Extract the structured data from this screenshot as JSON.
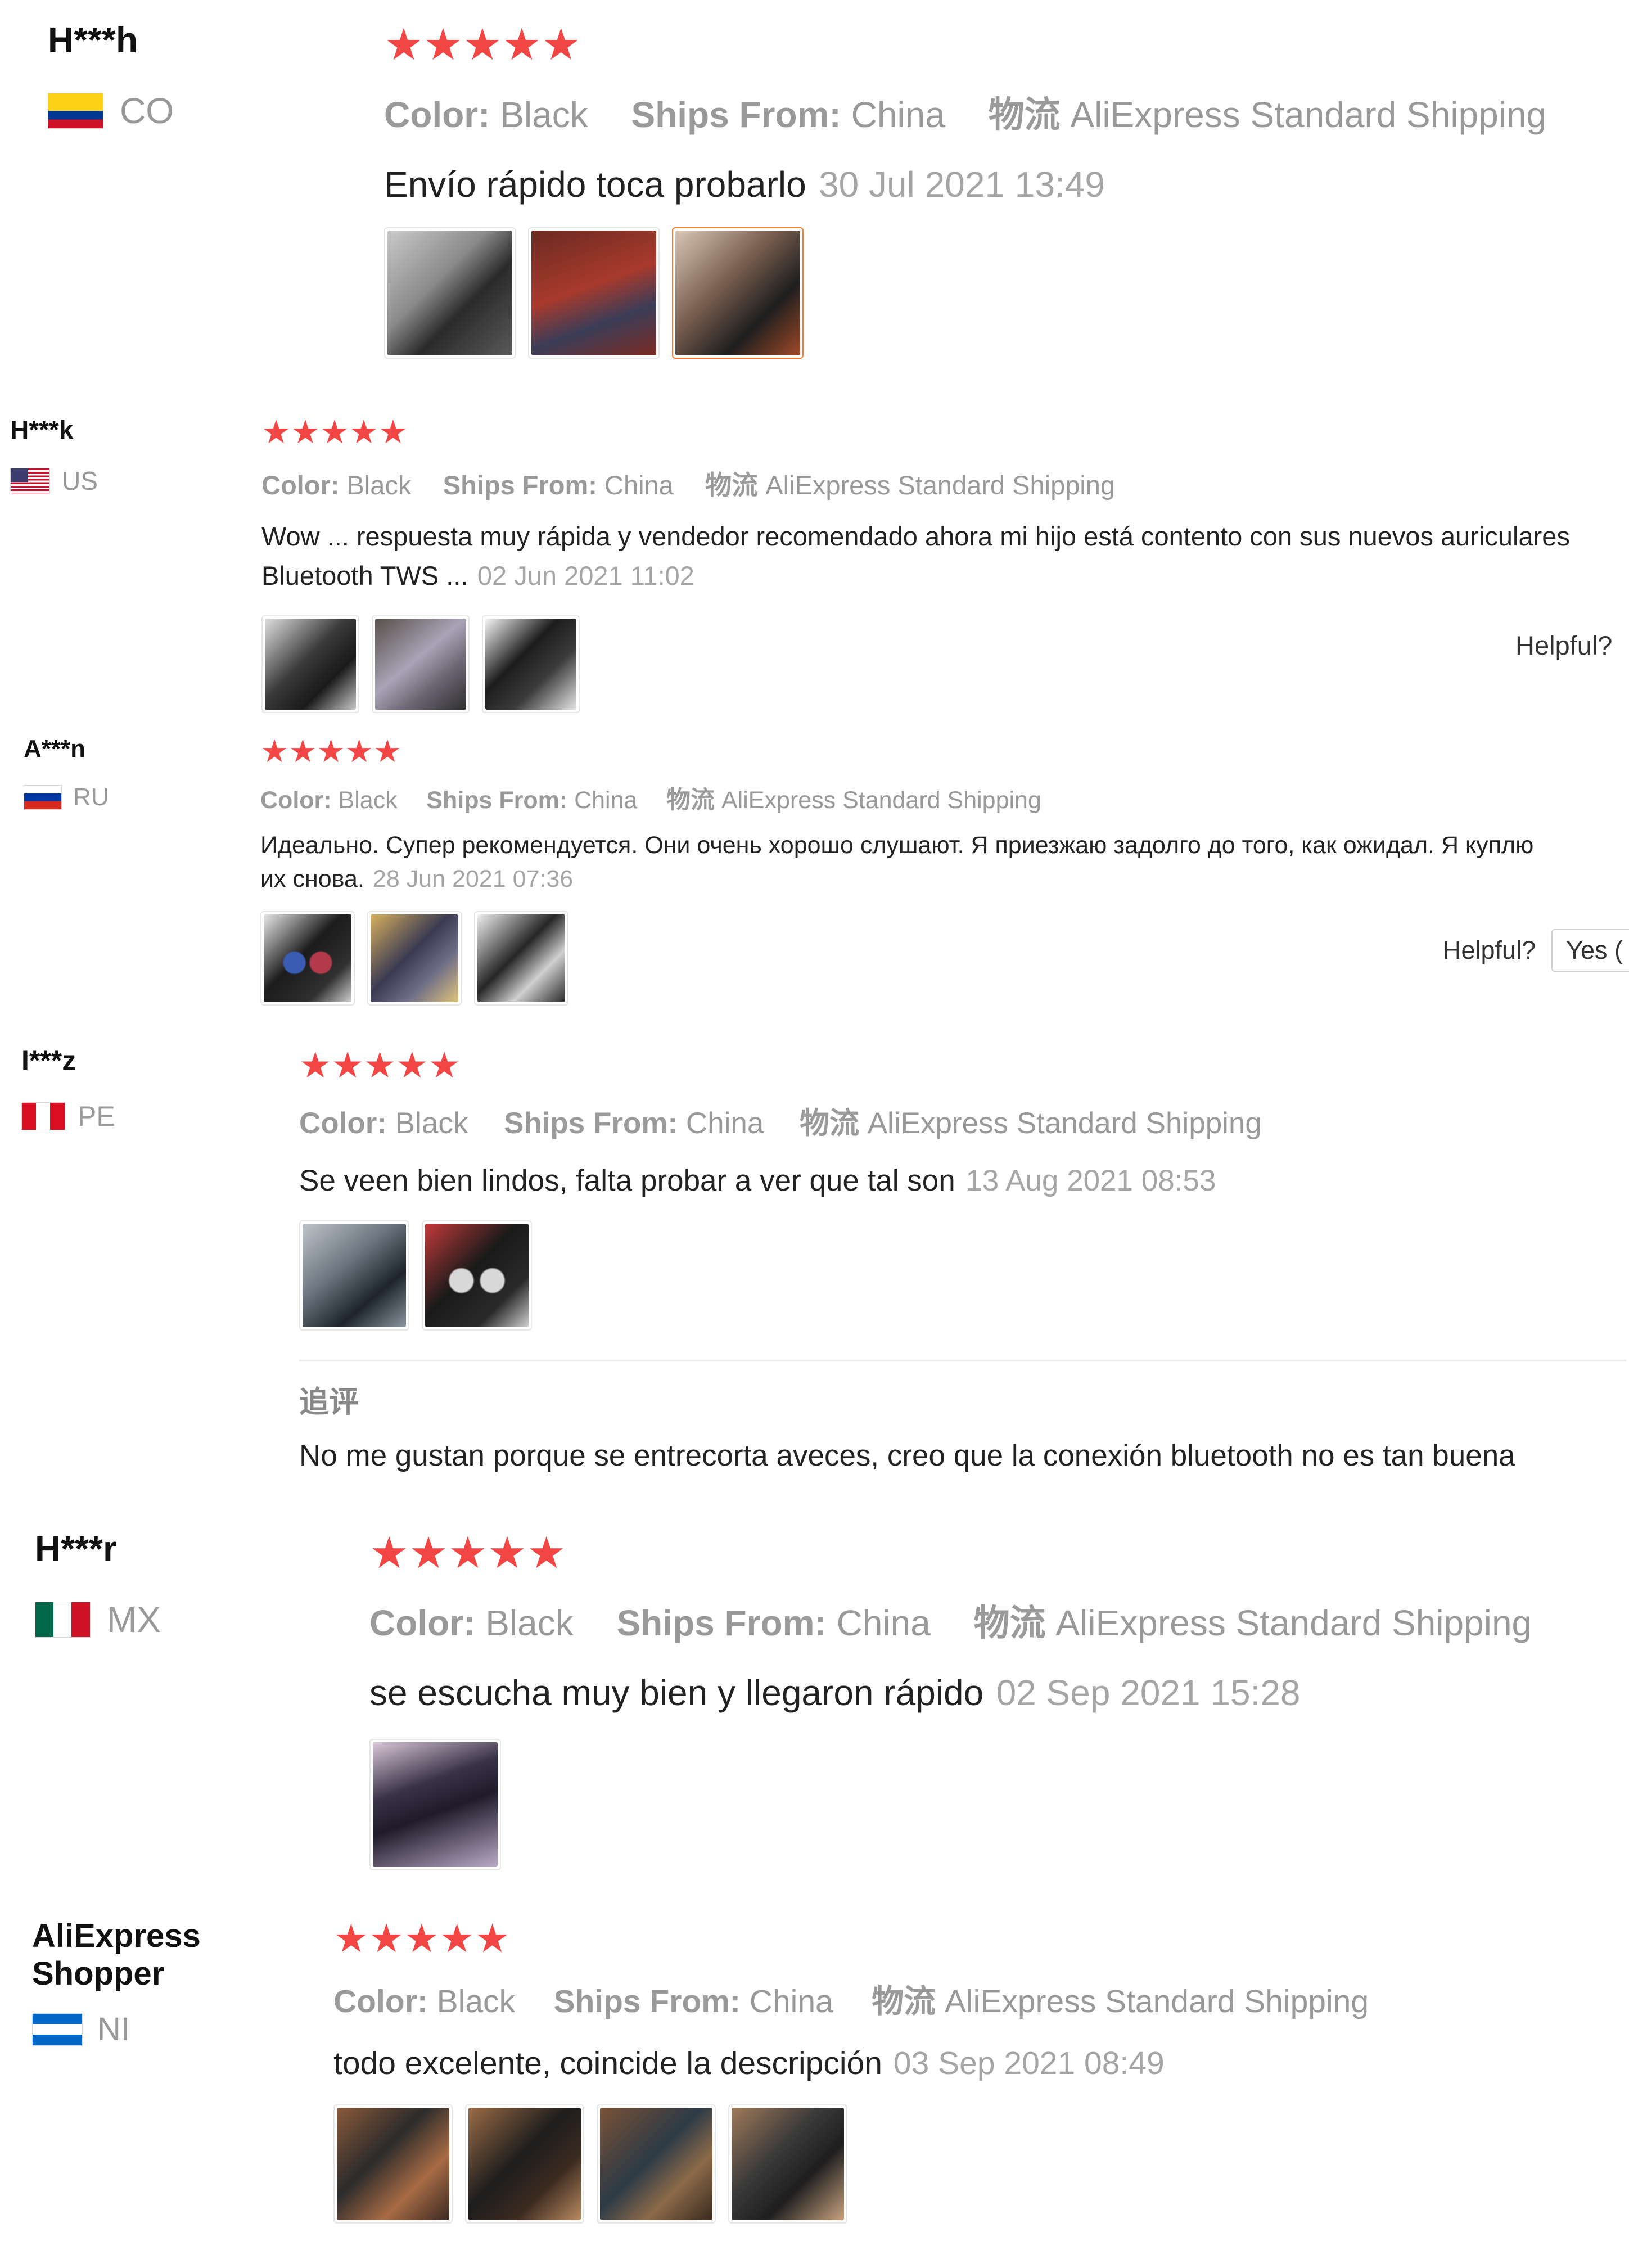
{
  "labels": {
    "color_key": "Color:",
    "ships_key": "Ships From:",
    "logistics_key": "物流",
    "helpful": "Helpful?",
    "yes": "Yes (",
    "followup": "追评"
  },
  "colors": {
    "star": "#f24645",
    "selected_border": "#ff7a2b",
    "muted": "#999999"
  },
  "reviews": [
    {
      "user": "H***h",
      "country": "CO",
      "stars": 5,
      "color": "Black",
      "ships_from": "China",
      "shipping": "AliExpress Standard Shipping",
      "text": "Envío rápido toca probarlo",
      "date": "30 Jul 2021 13:49",
      "photo_count": 3
    },
    {
      "user": "H***k",
      "country": "US",
      "stars": 5,
      "color": "Black",
      "ships_from": "China",
      "shipping": "AliExpress Standard Shipping",
      "text_line1": "Wow ... respuesta muy rápida y vendedor recomendado ahora mi hijo está contento con sus nuevos auriculares",
      "text_line2": "Bluetooth TWS ...",
      "date": "02 Jun 2021 11:02",
      "photo_count": 3
    },
    {
      "user": "A***n",
      "country": "RU",
      "stars": 5,
      "color": "Black",
      "ships_from": "China",
      "shipping": "AliExpress Standard Shipping",
      "text_line1": "Идеально. Супер рекомендуется. Они очень хорошо слушают. Я приезжаю задолго до того, как ожидал. Я куплю",
      "text_line2": "их снова.",
      "date": "28 Jun 2021 07:36",
      "photo_count": 3
    },
    {
      "user": "I***z",
      "country": "PE",
      "stars": 5,
      "color": "Black",
      "ships_from": "China",
      "shipping": "AliExpress Standard Shipping",
      "text": "Se veen bien lindos, falta probar a ver que tal son",
      "date": "13 Aug 2021 08:53",
      "photo_count": 2,
      "followup_text": "No me gustan porque se entrecorta aveces, creo que la conexión bluetooth no es tan buena"
    },
    {
      "user": "H***r",
      "country": "MX",
      "stars": 5,
      "color": "Black",
      "ships_from": "China",
      "shipping": "AliExpress Standard Shipping",
      "text": "se escucha muy bien y llegaron rápido",
      "date": "02 Sep 2021 15:28",
      "photo_count": 1
    },
    {
      "user_line1": "AliExpress",
      "user_line2": "Shopper",
      "country": "NI",
      "stars": 5,
      "color": "Black",
      "ships_from": "China",
      "shipping": "AliExpress Standard Shipping",
      "text": "todo excelente, coincide la descripción",
      "date": "03 Sep 2021 08:49",
      "photo_count": 4
    }
  ]
}
